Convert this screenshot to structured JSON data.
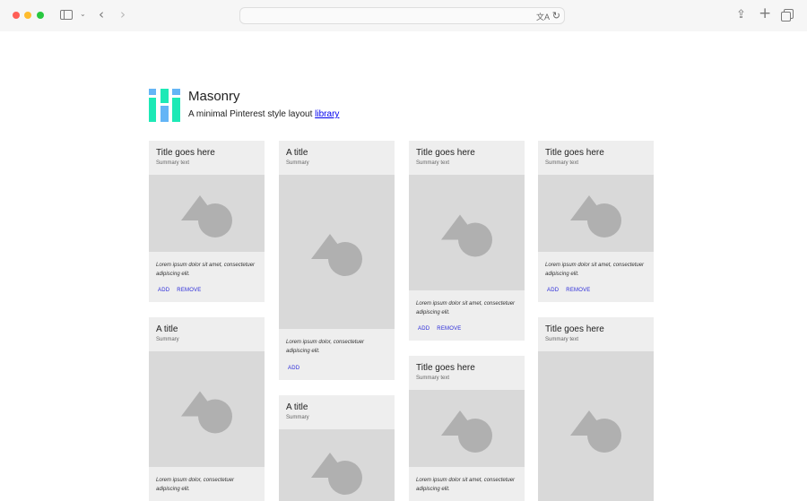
{
  "browser": {
    "address_text": ""
  },
  "header": {
    "title": "Masonry",
    "subtitle_text": "A minimal Pinterest style layout ",
    "subtitle_link": "library",
    "logo_colors": [
      "#64b5f6",
      "#1de9b6"
    ]
  },
  "cards": [
    {
      "title": "Title goes here",
      "summary": "Summary text",
      "body": "Lorem ipsum dolor sit amet, consectetuer adipiscing elit.",
      "add": "ADD",
      "remove": "REMOVE"
    },
    {
      "title": "A title",
      "summary": "Summary",
      "body": "Lorem ipsum dolor, consectetuer adipiscing elit.",
      "add": "",
      "remove": ""
    },
    {
      "title": "A title",
      "summary": "Summary",
      "body": "Lorem ipsum dolor, consectetuer adipiscing elit.",
      "add": "ADD",
      "remove": ""
    },
    {
      "title": "A title",
      "summary": "Summary",
      "body": "",
      "add": "",
      "remove": ""
    },
    {
      "title": "Title goes here",
      "summary": "Summary text",
      "body": "Lorem ipsum dolor sit amet, consectetuer adipiscing elit.",
      "add": "ADD",
      "remove": "REMOVE"
    },
    {
      "title": "Title goes here",
      "summary": "Summary text",
      "body": "Lorem ipsum dolor sit amet, consectetuer adipiscing elit.",
      "add": "",
      "remove": ""
    },
    {
      "title": "Title goes here",
      "summary": "Summary text",
      "body": "Lorem ipsum dolor sit amet, consectetuer adipiscing elit.",
      "add": "ADD",
      "remove": "REMOVE"
    },
    {
      "title": "Title goes here",
      "summary": "Summary text",
      "body": "",
      "add": "",
      "remove": ""
    }
  ]
}
